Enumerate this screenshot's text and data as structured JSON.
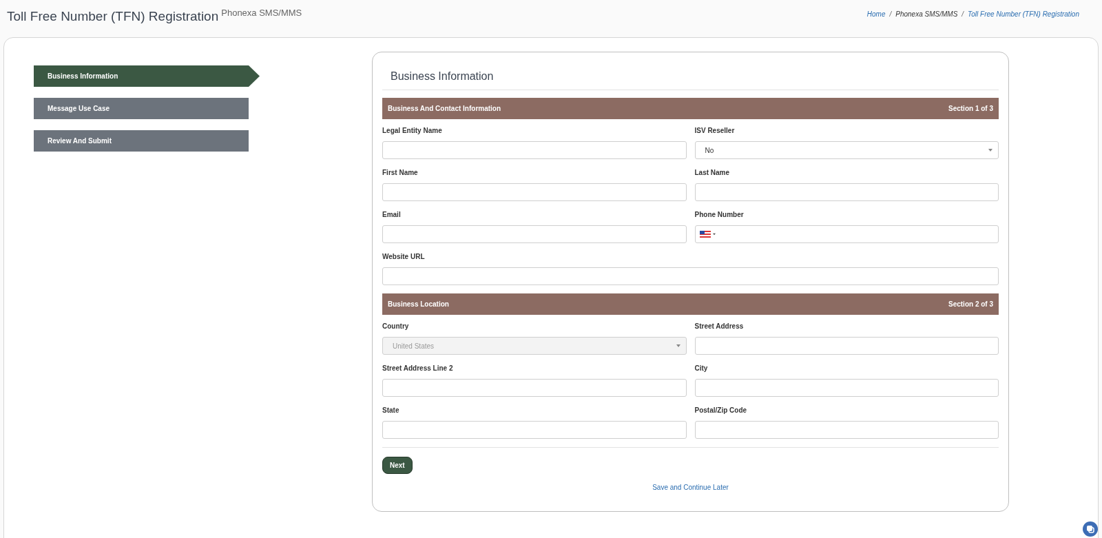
{
  "header": {
    "title": "Toll Free Number (TFN) Registration",
    "subtitle": "Phonexa SMS/MMS"
  },
  "breadcrumb": [
    {
      "label": "Home",
      "link": true
    },
    {
      "separator": "/"
    },
    {
      "label": "Phonexa SMS/MMS",
      "link": false
    },
    {
      "separator": "/"
    },
    {
      "label": "Toll Free Number (TFN) Registration",
      "link": true
    }
  ],
  "steps": [
    {
      "label": "Business Information",
      "selected": true
    },
    {
      "label": "Message Use Case",
      "selected": false
    },
    {
      "label": "Review And Submit",
      "selected": false
    }
  ],
  "form": {
    "title": "Business Information",
    "sections": [
      {
        "title": "Business And Contact Information",
        "counter": "Section 1 of 3",
        "fields": [
          {
            "label": "Legal Entity Name",
            "kind": "text",
            "wide": false
          },
          {
            "label": "ISV Reseller",
            "kind": "select",
            "value": "No",
            "wide": false,
            "disabled": false
          },
          {
            "label": "First Name",
            "kind": "text",
            "wide": false
          },
          {
            "label": "Last Name",
            "kind": "text",
            "wide": false
          },
          {
            "label": "Email",
            "kind": "text",
            "wide": false
          },
          {
            "label": "Phone Number",
            "kind": "phone",
            "wide": false
          },
          {
            "label": "Website URL",
            "kind": "text",
            "wide": true
          }
        ]
      },
      {
        "title": "Business Location",
        "counter": "Section 2 of 3",
        "fields": [
          {
            "label": "Country",
            "kind": "select",
            "value": "United States",
            "wide": false,
            "disabled": true
          },
          {
            "label": "Street Address",
            "kind": "text",
            "wide": false
          },
          {
            "label": "Street Address Line 2",
            "kind": "text",
            "wide": false
          },
          {
            "label": "City",
            "kind": "text",
            "wide": false
          },
          {
            "label": "State",
            "kind": "text",
            "wide": false
          },
          {
            "label": "Postal/Zip Code",
            "kind": "text",
            "wide": false
          }
        ]
      }
    ],
    "next_button": "Next",
    "save_link": "Save and Continue Later"
  }
}
